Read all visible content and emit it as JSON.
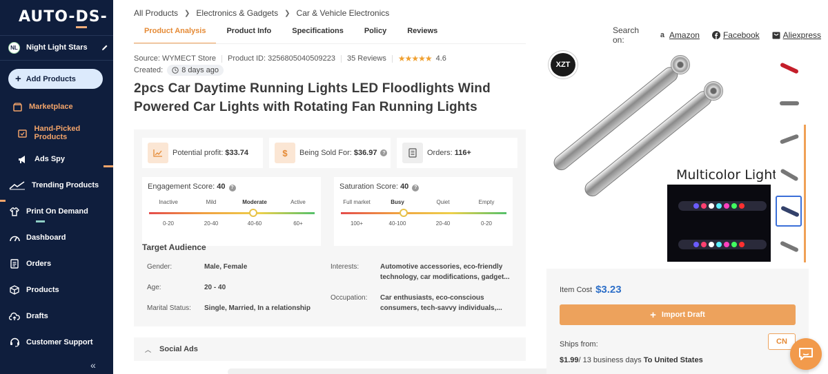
{
  "sidebar": {
    "logo": "AUTO-DS-",
    "store": {
      "initials": "NL",
      "name": "Night Light Stars"
    },
    "add_products": "Add Products",
    "items": [
      {
        "label": "Marketplace",
        "icon": "marketplace-icon"
      },
      {
        "label": "Hand-Picked Products",
        "icon": "hand-picked-icon"
      },
      {
        "label": "Ads Spy",
        "icon": "megaphone-icon"
      },
      {
        "label": "Trending Products",
        "icon": "trending-icon"
      },
      {
        "label": "Print On Demand",
        "icon": "shirt-icon"
      },
      {
        "label": "Dashboard",
        "icon": "gauge-icon"
      },
      {
        "label": "Orders",
        "icon": "orders-icon"
      },
      {
        "label": "Products",
        "icon": "box-icon"
      },
      {
        "label": "Drafts",
        "icon": "cloud-upload-icon"
      },
      {
        "label": "Customer Support",
        "icon": "headset-icon"
      }
    ],
    "collapse": "«",
    "accent": "#f3a46a"
  },
  "breadcrumb": [
    "All Products",
    "Electronics & Gadgets",
    "Car & Vehicle Electronics"
  ],
  "tabs": [
    "Product Analysis",
    "Product Info",
    "Specifications",
    "Policy",
    "Reviews"
  ],
  "search_on": {
    "label": "Search on:",
    "links": [
      "Amazon",
      "Facebook",
      "Aliexpress"
    ]
  },
  "meta": {
    "source": "Source: WYMECT Store",
    "product_id": "Product ID: 3256805040509223",
    "reviews": "35 Reviews",
    "stars": "★★★★★",
    "rating": "4.6",
    "created_label": "Created:",
    "created_value": "8 days ago"
  },
  "product_title": "2pcs Car Daytime Running Lights LED Floodlights Wind Powered Car Lights with Rotating Fan Running Lights",
  "stats": {
    "profit_label": "Potential profit:",
    "profit_value": "$33.74",
    "sold_label": "Being Sold For:",
    "sold_value": "$36.97",
    "orders_label": "Orders:",
    "orders_value": "116+"
  },
  "engagement": {
    "label": "Engagement Score:",
    "value": "40",
    "levels": [
      "Inactive",
      "Mild",
      "Moderate",
      "Active"
    ],
    "ranges": [
      "0-20",
      "20-40",
      "40-60",
      "60+"
    ],
    "selected_level": 2,
    "knob_position": 0.63
  },
  "saturation": {
    "label": "Saturation Score:",
    "value": "40",
    "levels": [
      "Full market",
      "Busy",
      "Quiet",
      "Empty"
    ],
    "ranges": [
      "100+",
      "40-100",
      "20-40",
      "0-20"
    ],
    "selected_level": 1,
    "knob_position": 0.38
  },
  "audience": {
    "title": "Target Audience",
    "gender_label": "Gender:",
    "gender": "Male, Female",
    "age_label": "Age:",
    "age": "20 - 40",
    "marital_label": "Marital Status:",
    "marital": "Single, Married, In a relationship",
    "interests_label": "Interests:",
    "interests_1": "Automotive accessories, eco-friendly",
    "interests_2": "technology, car modifications, gadget...",
    "occupation_label": "Occupation:",
    "occupation_1": "Car enthusiasts, eco-conscious",
    "occupation_2": "consumers, tech-savvy individuals,..."
  },
  "social_ads": "Social Ads",
  "gallery": {
    "brand": "XZT",
    "multicolor": "Multicolor Light"
  },
  "buy": {
    "item_cost_label": "Item Cost",
    "item_cost": "$3.23",
    "import": "Import Draft",
    "ships_from": "Ships from:",
    "country": "CN",
    "ship_price": "$1.99",
    "ship_days": "/ 13 business days",
    "ship_to": "To United States"
  }
}
